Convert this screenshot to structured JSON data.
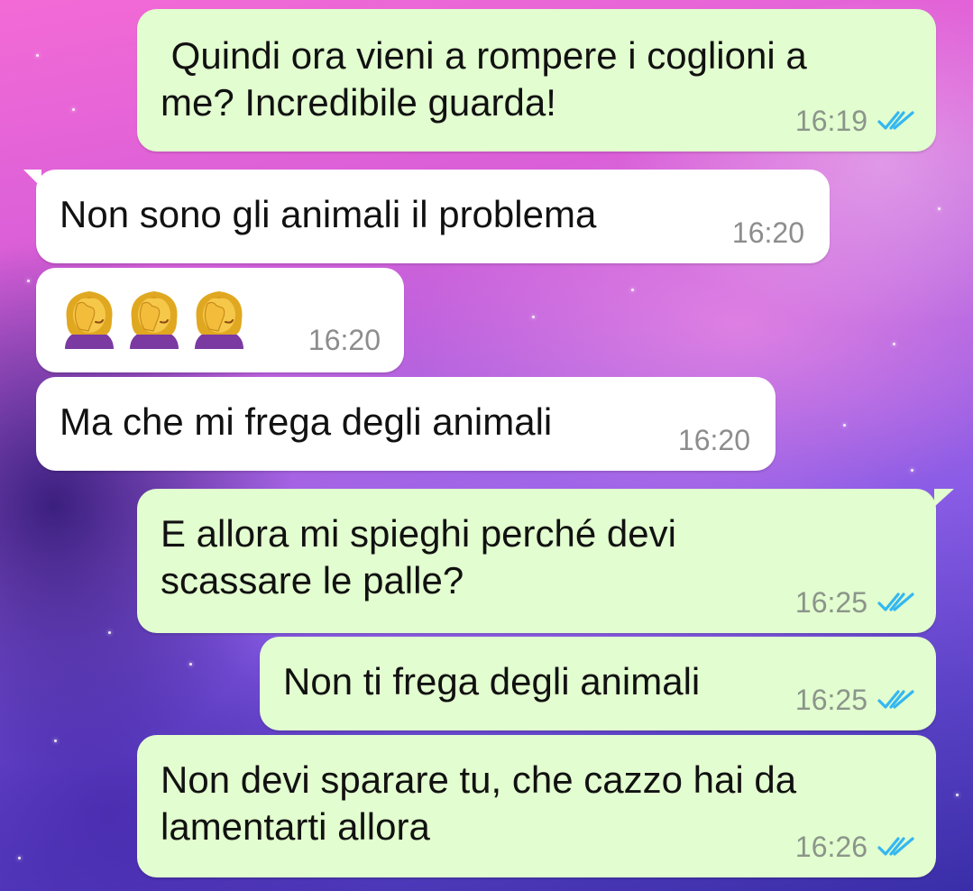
{
  "messages": [
    {
      "text": " Quindi ora vieni a rompere i coglioni a\nme? Incredibile guarda!",
      "time": "16:19",
      "direction": "outgoing",
      "status": "read"
    },
    {
      "text": "Non sono gli animali il problema",
      "time": "16:20",
      "direction": "incoming"
    },
    {
      "text": "",
      "emoji": [
        "woman-facepalming",
        "woman-facepalming",
        "woman-facepalming"
      ],
      "time": "16:20",
      "direction": "incoming"
    },
    {
      "text": "Ma che mi frega degli animali",
      "time": "16:20",
      "direction": "incoming"
    },
    {
      "text": "E allora mi spieghi perché devi\nscassare le palle?",
      "time": "16:25",
      "direction": "outgoing",
      "status": "read"
    },
    {
      "text": "Non ti frega degli animali",
      "time": "16:25",
      "direction": "outgoing",
      "status": "read"
    },
    {
      "text": "Non devi sparare tu, che cazzo hai da\nlamentarti allora",
      "time": "16:26",
      "direction": "outgoing",
      "status": "read"
    }
  ],
  "colors": {
    "outgoing_bubble": "#e2fdcf",
    "incoming_bubble": "#ffffff",
    "read_ticks": "#34b7f1"
  }
}
